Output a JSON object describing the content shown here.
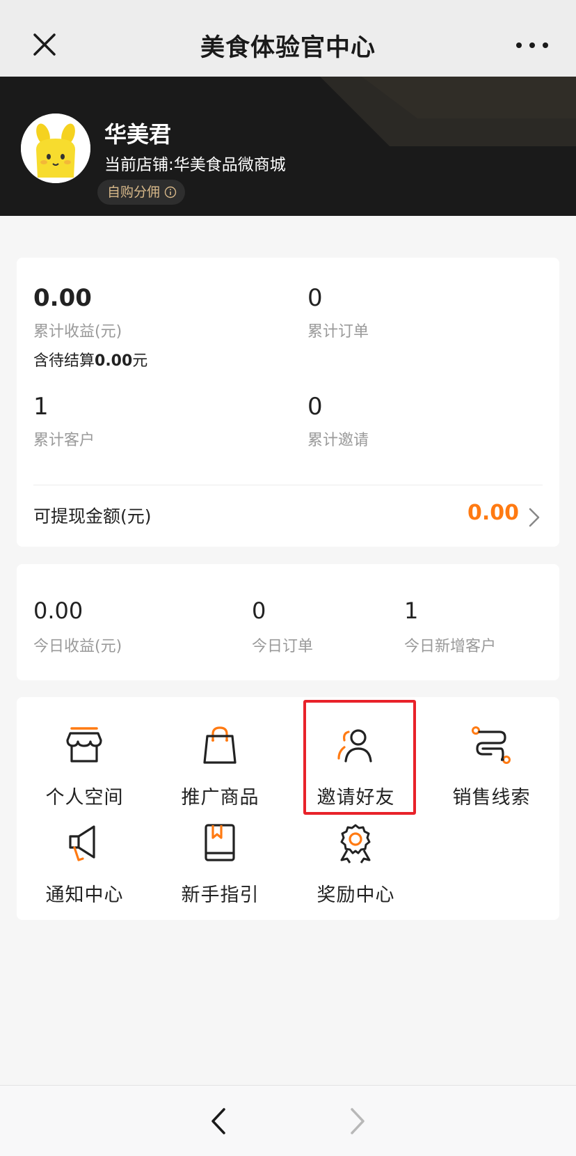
{
  "nav": {
    "title": "美食体验官中心",
    "close_icon": "close-icon",
    "more_icon": "more-icon"
  },
  "profile": {
    "name": "华美君",
    "store": "当前店铺:华美食品微商城",
    "badge": "自购分佣",
    "badge_icon": "info-icon"
  },
  "stats": {
    "total_income": {
      "value": "0.00",
      "label": "累计收益(元)"
    },
    "pending_prefix": "含待结算",
    "pending_amount": "0.00",
    "pending_unit": "元",
    "total_orders": {
      "value": "0",
      "label": "累计订单"
    },
    "total_customers": {
      "value": "1",
      "label": "累计客户"
    },
    "total_invites": {
      "value": "0",
      "label": "累计邀请"
    },
    "withdraw_label": "可提现金额(元)",
    "withdraw_amount": "0.00"
  },
  "today": {
    "income": {
      "value": "0.00",
      "label": "今日收益(元)"
    },
    "orders": {
      "value": "0",
      "label": "今日订单"
    },
    "new_customers": {
      "value": "1",
      "label": "今日新增客户"
    }
  },
  "menu": {
    "items": [
      {
        "label": "个人空间",
        "icon": "store-icon"
      },
      {
        "label": "推广商品",
        "icon": "shopping-bag-icon"
      },
      {
        "label": "邀请好友",
        "icon": "invite-friends-icon"
      },
      {
        "label": "销售线索",
        "icon": "sales-leads-icon"
      },
      {
        "label": "通知中心",
        "icon": "megaphone-icon"
      },
      {
        "label": "新手指引",
        "icon": "guide-book-icon"
      },
      {
        "label": "奖励中心",
        "icon": "award-medal-icon"
      }
    ]
  },
  "colors": {
    "accent": "#ff7a12",
    "header_bg": "#1a1a1a",
    "badge_text": "#d8b98a",
    "highlight": "#e8222a"
  }
}
